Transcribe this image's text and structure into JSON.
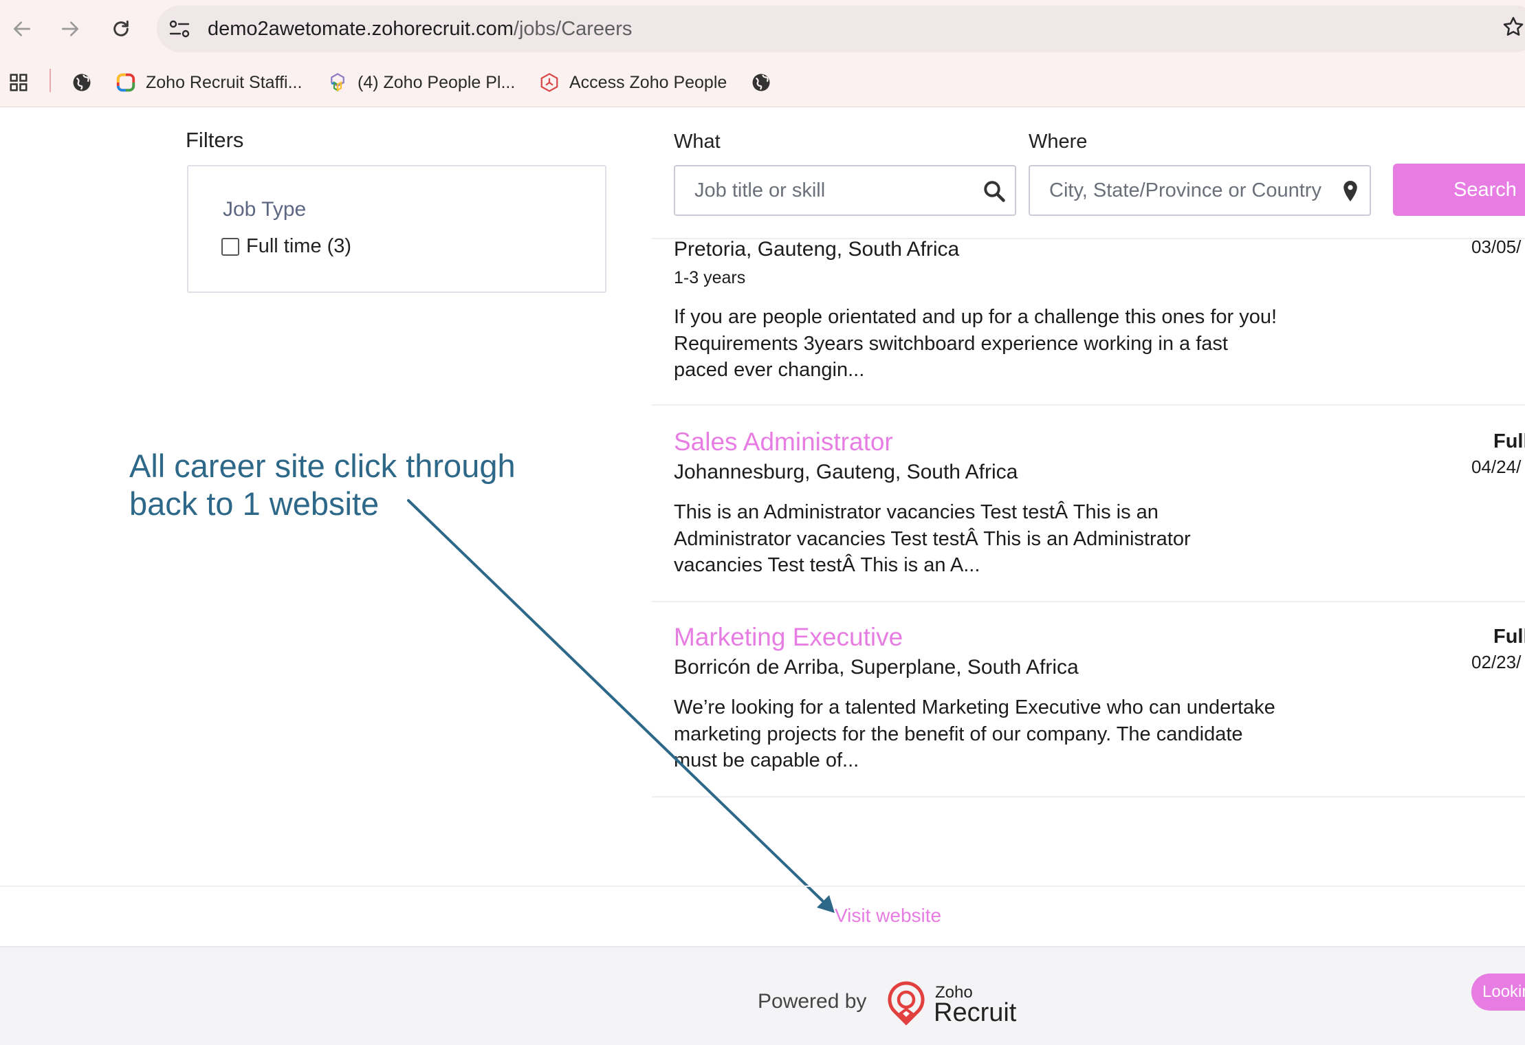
{
  "browser": {
    "url_host": "demo2awetomate.zohorecruit.com",
    "url_path": "/jobs/Careers",
    "bookmarks": [
      {
        "label": "Zoho Recruit Staffi..."
      },
      {
        "label": "(4) Zoho People Pl..."
      },
      {
        "label": "Access Zoho People"
      }
    ]
  },
  "filters": {
    "title": "Filters",
    "job_type_title": "Job Type",
    "options": [
      {
        "label": "Full time (3)"
      }
    ]
  },
  "search": {
    "what_label": "What",
    "what_placeholder": "Job title or skill",
    "where_label": "Where",
    "where_placeholder": "City, State/Province or Country",
    "button_label": "Search"
  },
  "jobs": [
    {
      "title": "",
      "location": "Pretoria, Gauteng, South Africa",
      "experience": "1-3 years",
      "description": "If you are people orientated and up for a challenge this ones for you! Requirements 3years switchboard experience working in a fast paced ever changin...",
      "type": "",
      "date": "03/05/"
    },
    {
      "title": "Sales Administrator",
      "location": "Johannesburg, Gauteng, South Africa",
      "experience": "",
      "description": "This is an Administrator vacancies Test testÂ This is an Administrator vacancies Test testÂ This is an Administrator vacancies Test testÂ This is an A...",
      "type": "Full",
      "date": "04/24/"
    },
    {
      "title": "Marketing Executive",
      "location": "Borricón de Arriba, Superplane, South Africa",
      "experience": "",
      "description": "We’re looking for a talented Marketing Executive who can undertake marketing projects for the benefit of our company. The candidate must be capable of...",
      "type": "Full",
      "date": "02/23/"
    }
  ],
  "annotation": {
    "line1": "All career site click through",
    "line2": "back to 1 website"
  },
  "visit_website": "Visit website",
  "footer": {
    "powered_by": "Powered by",
    "brand_small": "Zoho",
    "brand_big": "Recruit",
    "looking_button": "Looking"
  },
  "colors": {
    "accent": "#e77de3",
    "annotation": "#2d6889",
    "filter_heading": "#5d6784"
  },
  "icons": {
    "back": "arrow-left-icon",
    "forward": "arrow-right-icon",
    "reload": "reload-icon",
    "site_settings": "tune-icon",
    "bookmark": "star-icon",
    "apps": "apps-grid-icon",
    "globe": "globe-icon",
    "what_field": "search-icon",
    "where_field": "location-pin-icon"
  }
}
